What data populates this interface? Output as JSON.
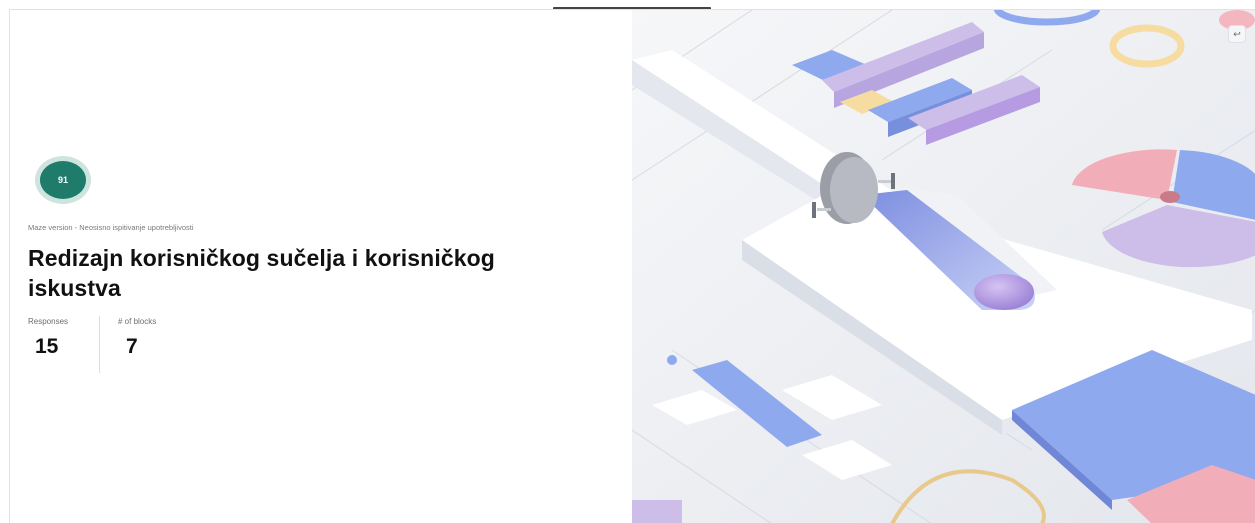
{
  "project": {
    "score": "91",
    "meta": "Maze version - Neosisno ispitivanje upotrebljivosti",
    "title": "Redizajn korisničkog sučelja i korisničkog iskustva"
  },
  "stats": [
    {
      "label": "Responses",
      "value": "15"
    },
    {
      "label": "# of blocks",
      "value": "7"
    }
  ],
  "hero": {
    "icon": "external-link-icon",
    "colors": {
      "lavender": "#cdbde9",
      "blue": "#8fa9ee",
      "pink": "#f2aeb8",
      "yellow": "#f7dca2",
      "purple": "#b69be3",
      "teal": "#1f7b6a"
    }
  }
}
